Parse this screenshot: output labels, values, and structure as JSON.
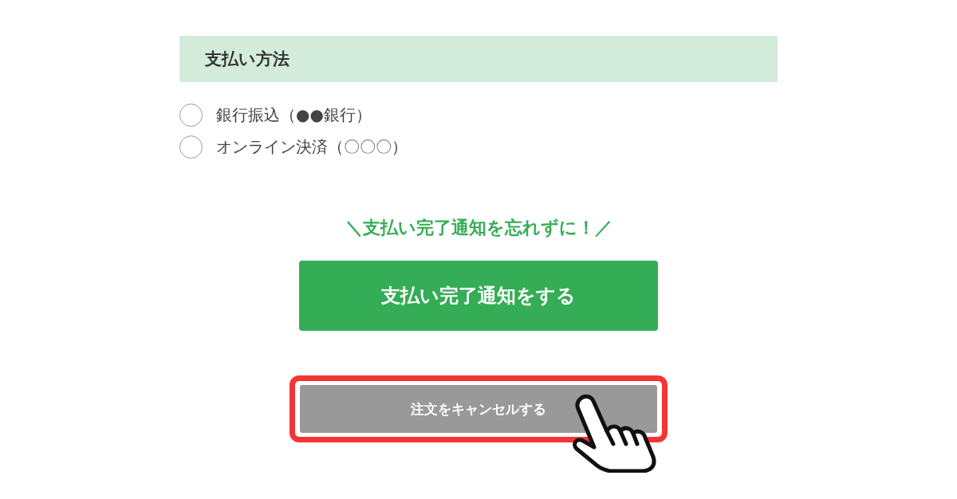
{
  "section": {
    "title": "支払い方法"
  },
  "payment_options": [
    {
      "label": "銀行振込（●●銀行）",
      "selected": false
    },
    {
      "label": "オンライン決済（〇〇〇）",
      "selected": false
    }
  ],
  "reminder": "＼支払い完了通知を忘れずに！／",
  "notify_button": {
    "label": "支払い完了通知をする"
  },
  "cancel_button": {
    "label": "注文をキャンセルする",
    "highlighted": true
  }
}
